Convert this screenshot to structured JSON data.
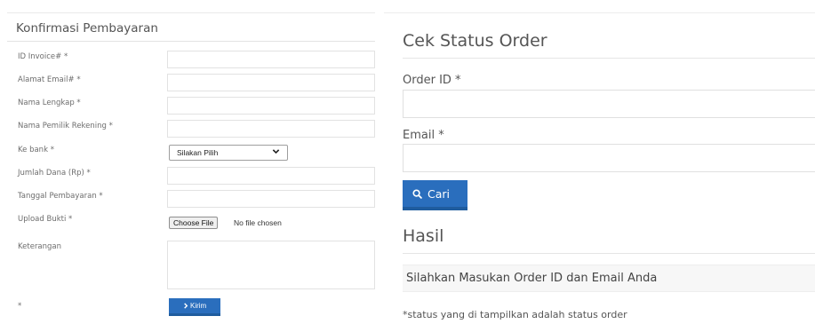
{
  "payment_form": {
    "title": "Konfirmasi Pembayaran",
    "fields": {
      "invoice_id": "ID Invoice# *",
      "email": "Alamat Email# *",
      "full_name": "Nama Lengkap *",
      "account_owner": "Nama Pemilik Rekening *",
      "bank": "Ke bank *",
      "amount": "Jumlah Dana (Rp) *",
      "payment_date": "Tanggal Pembayaran *",
      "upload": "Upload Bukti *",
      "notes": "Keterangan",
      "required_note": "*"
    },
    "bank_select_value": "Silakan Pilih",
    "file_button_label": "Choose File",
    "file_status": "No file chosen",
    "submit_label": "Kirim"
  },
  "order_status": {
    "title": "Cek Status Order",
    "order_id_label": "Order ID *",
    "email_label": "Email *",
    "search_label": "Cari",
    "result_title": "Hasil",
    "result_message": "Silahkan Masukan Order ID dan Email Anda",
    "footnote": "*status yang di tampilkan adalah status order"
  },
  "colors": {
    "accent": "#2a6ebd"
  }
}
